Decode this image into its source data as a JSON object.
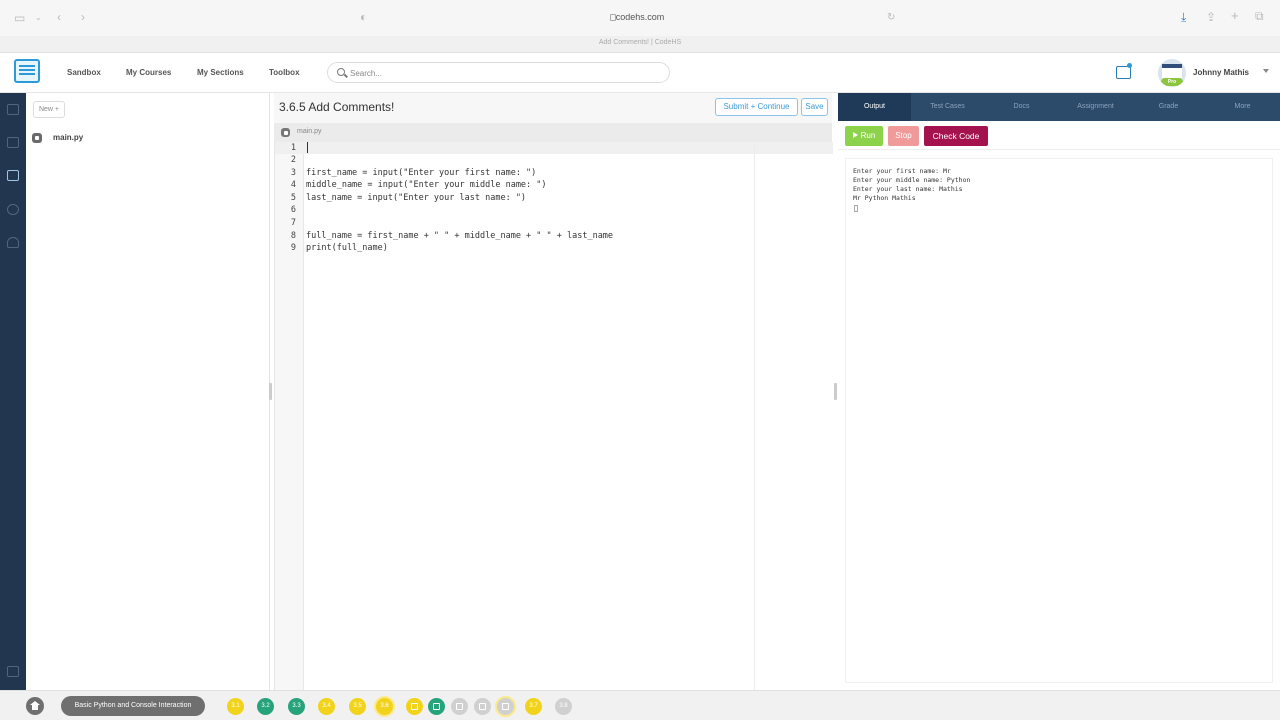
{
  "browser": {
    "url": "codehs.com",
    "tab_title": "Add Comments! | CodeHS"
  },
  "header": {
    "nav": [
      "Sandbox",
      "My Courses",
      "My Sections",
      "Toolbox"
    ],
    "search_placeholder": "Search...",
    "user_name": "Johnny Mathis",
    "avatar_badge": "Pro"
  },
  "sidebar": {
    "new_label": "New +",
    "files": [
      "main.py"
    ]
  },
  "editor": {
    "title": "3.6.5 Add Comments!",
    "submit_label": "Submit + Continue",
    "save_label": "Save",
    "file_tab": "main.py",
    "lines": [
      {
        "n": "1",
        "code": ""
      },
      {
        "n": "2",
        "code": ""
      },
      {
        "n": "3",
        "code": "first_name = input(\"Enter your first name: \")"
      },
      {
        "n": "4",
        "code": "middle_name = input(\"Enter your middle name: \")"
      },
      {
        "n": "5",
        "code": "last_name = input(\"Enter your last name: \")"
      },
      {
        "n": "6",
        "code": ""
      },
      {
        "n": "7",
        "code": ""
      },
      {
        "n": "8",
        "code": "full_name = first_name + \" \" + middle_name + \" \" + last_name"
      },
      {
        "n": "9",
        "code": "print(full_name)"
      }
    ]
  },
  "output_panel": {
    "tabs": [
      "Output",
      "Test Cases",
      "Docs",
      "Assignment",
      "Grade",
      "More"
    ],
    "run_label": "Run",
    "stop_label": "Stop",
    "check_label": "Check Code",
    "console": [
      "Enter your first name: Mr",
      "Enter your middle name: Python",
      "Enter your last name: Mathis",
      "Mr Python Mathis"
    ]
  },
  "bottom_bar": {
    "unit_label": "Basic Python and Console Interaction",
    "progress": [
      {
        "label": "3.1",
        "color": "#f2d31b"
      },
      {
        "label": "3.2",
        "color": "#27a37b"
      },
      {
        "label": "3.3",
        "color": "#27a37b"
      },
      {
        "label": "3.4",
        "color": "#f2d31b"
      },
      {
        "label": "3.5",
        "color": "#f2d31b"
      },
      {
        "label": "3.6",
        "color": "#f2d31b"
      },
      {
        "label": "3.7",
        "color": "#f2d31b"
      },
      {
        "label": "3.8",
        "color": "#d0d0d0"
      }
    ]
  },
  "colors": {
    "rail": "#22374f",
    "output_tabs": "#2c4a6a",
    "run": "#8cd24a",
    "stop": "#f09a9a",
    "check_code": "#a5134f",
    "accent": "#2b9ad6"
  }
}
